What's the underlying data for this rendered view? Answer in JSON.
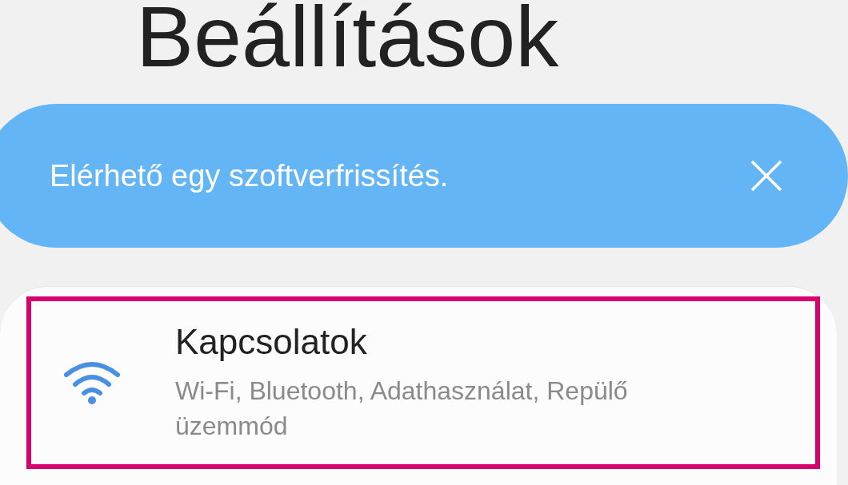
{
  "title": "Beállítások",
  "banner": {
    "text": "Elérhető egy szoftverfrissítés.",
    "dismissible": true
  },
  "items": [
    {
      "title": "Kapcsolatok",
      "subtitle": "Wi-Fi, Bluetooth, Adathasználat, Repülő üzemmód",
      "highlighted": true
    }
  ]
}
